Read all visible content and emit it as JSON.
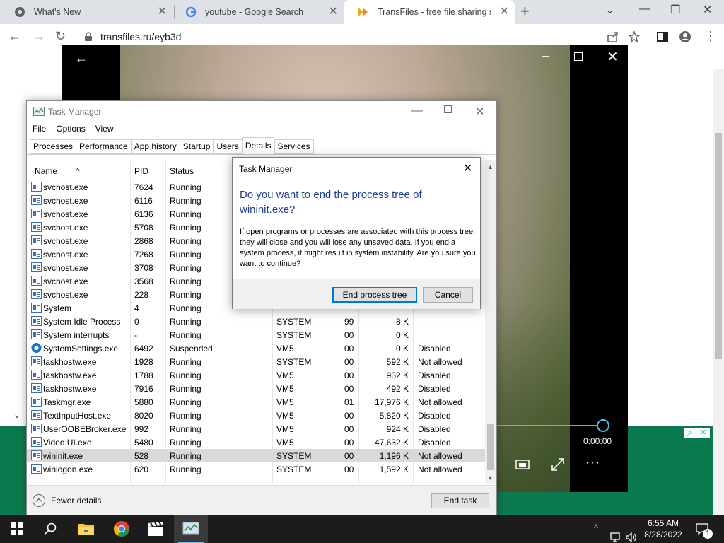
{
  "browser": {
    "tabs": [
      {
        "title": "What's New"
      },
      {
        "title": "youtube - Google Search"
      },
      {
        "title": "TransFiles - free file sharing servi"
      }
    ],
    "url": "transfiles.ru/eyb3d"
  },
  "viewer": {
    "time": "0:00:00",
    "accent_color": "#57b6e6"
  },
  "task_manager": {
    "title": "Task Manager",
    "menu": [
      "File",
      "Options",
      "View"
    ],
    "tabs": [
      "Processes",
      "Performance",
      "App history",
      "Startup",
      "Users",
      "Details",
      "Services"
    ],
    "active_tab": "Details",
    "columns": {
      "name": "Name",
      "pid": "PID",
      "status": "Status"
    },
    "rows": [
      {
        "name": "svchost.exe",
        "pid": "7624",
        "status": "Running",
        "user": "",
        "cpu": "",
        "mem": "",
        "uac": ""
      },
      {
        "name": "svchost.exe",
        "pid": "6116",
        "status": "Running",
        "user": "",
        "cpu": "",
        "mem": "",
        "uac": ""
      },
      {
        "name": "svchost.exe",
        "pid": "6136",
        "status": "Running",
        "user": "",
        "cpu": "",
        "mem": "",
        "uac": ""
      },
      {
        "name": "svchost.exe",
        "pid": "5708",
        "status": "Running",
        "user": "",
        "cpu": "",
        "mem": "",
        "uac": ""
      },
      {
        "name": "svchost.exe",
        "pid": "2868",
        "status": "Running",
        "user": "",
        "cpu": "",
        "mem": "",
        "uac": ""
      },
      {
        "name": "svchost.exe",
        "pid": "7268",
        "status": "Running",
        "user": "",
        "cpu": "",
        "mem": "",
        "uac": ""
      },
      {
        "name": "svchost.exe",
        "pid": "3708",
        "status": "Running",
        "user": "",
        "cpu": "",
        "mem": "",
        "uac": ""
      },
      {
        "name": "svchost.exe",
        "pid": "3568",
        "status": "Running",
        "user": "",
        "cpu": "",
        "mem": "",
        "uac": ""
      },
      {
        "name": "svchost.exe",
        "pid": "228",
        "status": "Running",
        "user": "",
        "cpu": "",
        "mem": "",
        "uac": ""
      },
      {
        "name": "System",
        "pid": "4",
        "status": "Running",
        "user": "",
        "cpu": "",
        "mem": "",
        "uac": ""
      },
      {
        "name": "System Idle Process",
        "pid": "0",
        "status": "Running",
        "user": "SYSTEM",
        "cpu": "99",
        "mem": "8 K",
        "uac": ""
      },
      {
        "name": "System interrupts",
        "pid": "-",
        "status": "Running",
        "user": "SYSTEM",
        "cpu": "00",
        "mem": "0 K",
        "uac": ""
      },
      {
        "name": "SystemSettings.exe",
        "pid": "6492",
        "status": "Suspended",
        "user": "VM5",
        "cpu": "00",
        "mem": "0 K",
        "uac": "Disabled",
        "icon": "gear"
      },
      {
        "name": "taskhostw.exe",
        "pid": "1928",
        "status": "Running",
        "user": "SYSTEM",
        "cpu": "00",
        "mem": "592 K",
        "uac": "Not allowed"
      },
      {
        "name": "taskhostw.exe",
        "pid": "1788",
        "status": "Running",
        "user": "VM5",
        "cpu": "00",
        "mem": "932 K",
        "uac": "Disabled"
      },
      {
        "name": "taskhostw.exe",
        "pid": "7916",
        "status": "Running",
        "user": "VM5",
        "cpu": "00",
        "mem": "492 K",
        "uac": "Disabled"
      },
      {
        "name": "Taskmgr.exe",
        "pid": "5880",
        "status": "Running",
        "user": "VM5",
        "cpu": "01",
        "mem": "17,976 K",
        "uac": "Not allowed"
      },
      {
        "name": "TextInputHost.exe",
        "pid": "8020",
        "status": "Running",
        "user": "VM5",
        "cpu": "00",
        "mem": "5,820 K",
        "uac": "Disabled"
      },
      {
        "name": "UserOOBEBroker.exe",
        "pid": "992",
        "status": "Running",
        "user": "VM5",
        "cpu": "00",
        "mem": "924 K",
        "uac": "Disabled"
      },
      {
        "name": "Video.UI.exe",
        "pid": "5480",
        "status": "Running",
        "user": "VM5",
        "cpu": "00",
        "mem": "47,632 K",
        "uac": "Disabled"
      },
      {
        "name": "wininit.exe",
        "pid": "528",
        "status": "Running",
        "user": "SYSTEM",
        "cpu": "00",
        "mem": "1,196 K",
        "uac": "Not allowed",
        "selected": true
      },
      {
        "name": "winlogon.exe",
        "pid": "620",
        "status": "Running",
        "user": "SYSTEM",
        "cpu": "00",
        "mem": "1,592 K",
        "uac": "Not allowed"
      }
    ],
    "fewer_details": "Fewer details",
    "end_task": "End task"
  },
  "dialog": {
    "title": "Task Manager",
    "question": "Do you want to end the process tree of wininit.exe?",
    "body": "If open programs or processes are associated with this process tree, they will close and you will lose any unsaved data. If you end a system process, it might result in system instability. Are you sure you want to continue?",
    "confirm": "End process tree",
    "cancel": "Cancel"
  },
  "taskbar": {
    "time": "6:55 AM",
    "date": "8/28/2022",
    "notification_count": "1"
  }
}
